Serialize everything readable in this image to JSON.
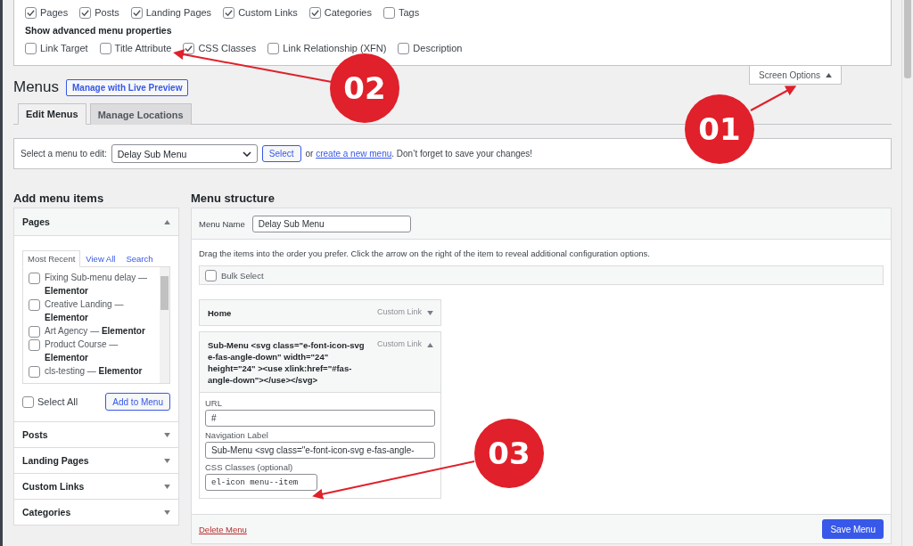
{
  "screen_options": {
    "post_types": [
      {
        "label": "Pages",
        "checked": true
      },
      {
        "label": "Posts",
        "checked": true
      },
      {
        "label": "Landing Pages",
        "checked": true
      },
      {
        "label": "Custom Links",
        "checked": true
      },
      {
        "label": "Categories",
        "checked": true
      },
      {
        "label": "Tags",
        "checked": false
      }
    ],
    "advanced_heading": "Show advanced menu properties",
    "advanced": [
      {
        "label": "Link Target",
        "checked": false
      },
      {
        "label": "Title Attribute",
        "checked": false
      },
      {
        "label": "CSS Classes",
        "checked": true
      },
      {
        "label": "Link Relationship (XFN)",
        "checked": false
      },
      {
        "label": "Description",
        "checked": false
      }
    ],
    "toggle": {
      "label": "Screen Options",
      "expanded": true
    }
  },
  "header": {
    "title": "Menus",
    "live_preview": "Manage with Live Preview"
  },
  "tabs": [
    {
      "label": "Edit Menus",
      "selected": true
    },
    {
      "label": "Manage Locations",
      "selected": false
    }
  ],
  "menu_select": {
    "label": "Select a menu to edit:",
    "value": "Delay Sub Menu",
    "button": "Select",
    "text_before": "or",
    "link": "create a new menu",
    "text_after": ". Don’t forget to save your changes!"
  },
  "add_items": {
    "title": "Add menu items",
    "sections": [
      {
        "title": "Pages",
        "expanded": true,
        "tabs": [
          {
            "label": "Most Recent",
            "selected": true
          },
          {
            "label": "View All",
            "selected": false
          },
          {
            "label": "Search",
            "selected": false
          }
        ],
        "items": [
          {
            "label": "Fixing Sub-menu delay — **Elementor**",
            "checked": false
          },
          {
            "label": "Creative Landing — **Elementor**",
            "checked": false
          },
          {
            "label": "Art Agency — **Elementor**",
            "checked": false
          },
          {
            "label": "Product Course — **Elementor**",
            "checked": false
          },
          {
            "label": "cls-testing — **Elementor**",
            "checked": false
          }
        ],
        "select_all": {
          "label": "Select All",
          "checked": false
        },
        "add_button": "Add to Menu"
      },
      {
        "title": "Posts",
        "expanded": false
      },
      {
        "title": "Landing Pages",
        "expanded": false
      },
      {
        "title": "Custom Links",
        "expanded": false
      },
      {
        "title": "Categories",
        "expanded": false
      }
    ]
  },
  "menu_structure": {
    "title": "Menu structure",
    "name_label": "Menu Name",
    "name_value": "Delay Sub Menu",
    "instructions": "Drag the items into the order you prefer. Click the arrow on the right of the item to reveal additional configuration options.",
    "bulk_select": {
      "label": "Bulk Select",
      "checked": false
    },
    "items": [
      {
        "title": "Home",
        "type": "Custom Link",
        "expanded": false
      },
      {
        "title": "Sub-Menu <svg class=\"e-font-icon-svg e-fas-angle-down\" width=\"24\" height=\"24\" ><use xlink:href=\"#fas-angle-down\"></use></svg>",
        "type": "Custom Link",
        "expanded": true,
        "fields": [
          {
            "label": "URL",
            "value": "#",
            "kind": "wide"
          },
          {
            "label": "Navigation Label",
            "value": "Sub-Menu <svg class=\"e-font-icon-svg e-fas-angle-",
            "kind": "wide"
          },
          {
            "label": "CSS Classes (optional)",
            "value": "el-icon menu--item",
            "kind": "code"
          }
        ]
      }
    ],
    "delete": "Delete Menu",
    "save": "Save Menu"
  },
  "annotations": [
    {
      "label": "01"
    },
    {
      "label": "02"
    },
    {
      "label": "03"
    }
  ]
}
